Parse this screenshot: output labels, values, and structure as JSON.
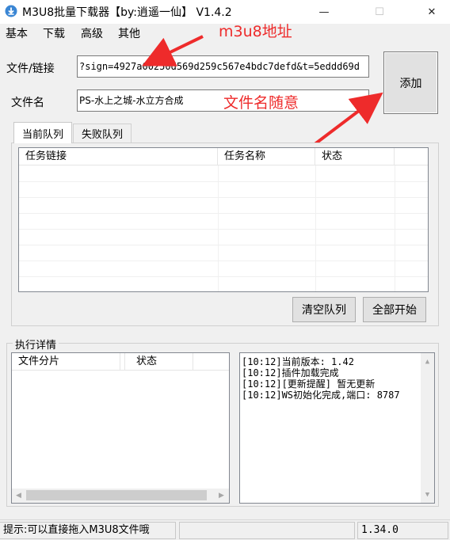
{
  "window": {
    "title": "M3U8批量下载器【by:逍遥一仙】 V1.4.2",
    "minimize_glyph": "—",
    "maximize_glyph": "☐",
    "close_glyph": "✕"
  },
  "menu": {
    "items": [
      "基本",
      "下载",
      "高级",
      "其他"
    ]
  },
  "form": {
    "url_label": "文件/链接",
    "url_value": "?sign=4927a00250d569d259c567e4bdc7defd&t=5eddd69d",
    "name_label": "文件名",
    "name_value": "PS-水上之城-水立方合成",
    "add_button": "添加"
  },
  "annotations": {
    "url_note": "m3u8地址",
    "name_note": "文件名随意",
    "color": "#ee2b2b"
  },
  "queue": {
    "tabs": [
      "当前队列",
      "失败队列"
    ],
    "active_tab": 0,
    "columns": [
      "任务链接",
      "任务名称",
      "状态"
    ],
    "rows": [],
    "clear_button": "清空队列",
    "start_button": "全部开始"
  },
  "details": {
    "group_title": "执行详情",
    "columns": [
      "文件分片",
      "状态"
    ],
    "log": [
      "[10:12]当前版本: 1.42",
      "[10:12]插件加载完成",
      "[10:12][更新提醒] 暂无更新",
      "[10:12]WS初始化完成,端口: 8787"
    ]
  },
  "icons": {
    "app": "download-icon",
    "scroll_left": "◀",
    "scroll_right": "▶",
    "scroll_up": "▲",
    "scroll_down": "▼"
  },
  "status": {
    "hint": "提示:可以直接拖入M3U8文件哦",
    "version": "1.34.0"
  }
}
